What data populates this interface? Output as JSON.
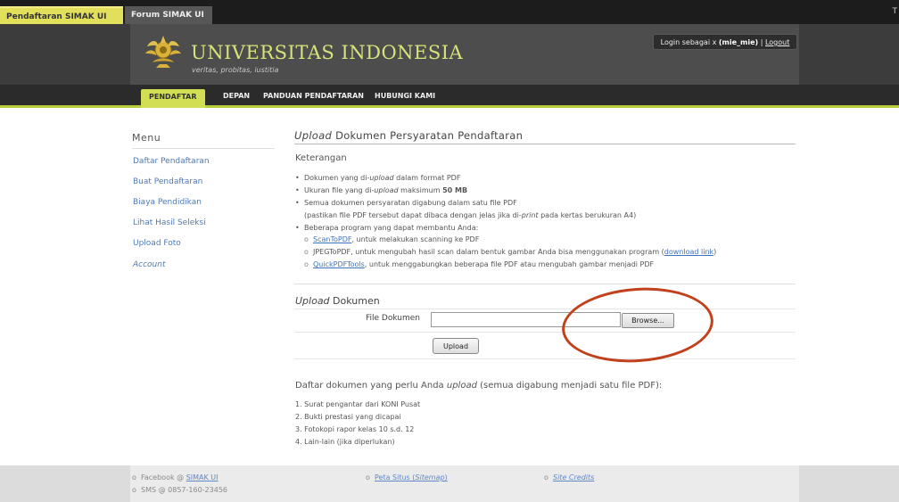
{
  "top_tabs": [
    {
      "label": "Pendaftaran SIMAK UI",
      "active": true
    },
    {
      "label": "Forum SIMAK UI",
      "active": false
    }
  ],
  "top_edge_text": "T",
  "header": {
    "title": "UNIVERSITAS INDONESIA",
    "motto": "veritas, probitas, iustitia",
    "login_prefix": "Login sebagai x ",
    "login_user": "(mie_mie)",
    "login_sep": " | ",
    "logout": "Logout"
  },
  "nav": [
    "PENDAFTAR",
    "DEPAN",
    "PANDUAN PENDAFTARAN",
    "HUBUNGI KAMI"
  ],
  "sidebar": {
    "title": "Menu",
    "items": [
      "Daftar Pendaftaran",
      "Buat Pendaftaran",
      "Biaya Pendidikan",
      "Lihat Hasil Seleksi",
      "Upload Foto",
      "Account"
    ]
  },
  "main": {
    "title_italic": "Upload",
    "title_rest": " Dokumen Persyaratan Pendaftaran",
    "keterangan": "Keterangan",
    "notes": {
      "n1_a": "Dokumen yang di-",
      "n1_i": "upload",
      "n1_b": " dalam format PDF",
      "n2_a": "Ukuran file yang di-",
      "n2_i": "upload",
      "n2_b": " maksimum ",
      "n2_c": "50 MB",
      "n3": "Semua dokumen persyaratan digabung dalam satu file PDF",
      "n3_sub_a": "(pastikan file PDF tersebut dapat dibaca dengan jelas jika di-",
      "n3_sub_i": "print",
      "n3_sub_b": " pada kertas berukuran A4)",
      "n4": "Beberapa program yang dapat membantu Anda:",
      "p1_link": "ScanToPDF",
      "p1_text": ", untuk melakukan scanning ke PDF",
      "p2_text": "JPEGToPDF, untuk mengubah hasil scan dalam bentuk gambar Anda bisa menggunakan program (",
      "p2_link": "download link",
      "p2_close": ")",
      "p3_link": "QuickPDFTools",
      "p3_text": ", untuk menggabungkan beberapa file PDF atau mengubah gambar menjadi PDF"
    },
    "upload": {
      "title_italic": "Upload",
      "title_rest": " Dokumen",
      "field_label": "File Dokumen",
      "file_value": "",
      "browse": "Browse...",
      "submit": "Upload"
    },
    "list": {
      "title_a": "Daftar dokumen yang perlu Anda ",
      "title_i": "upload",
      "title_b": " (semua digabung menjadi satu file PDF):",
      "items": [
        "1.  Surat pengantar dari KONI Pusat",
        "2.  Bukti prestasi yang dicapai",
        "3.  Fotokopi rapor kelas 10 s.d. 12",
        "4.  Lain-lain (jika diperlukan)"
      ]
    }
  },
  "footer": {
    "facebook_prefix": "Facebook @ ",
    "facebook_link": "SIMAK UI",
    "sms": "SMS @ 0857-160-23456",
    "sitemap_a": "Peta Situs (",
    "sitemap_i": "Sitemap",
    "sitemap_b": ")",
    "credits": "Site Credits",
    "bullet": "o"
  },
  "colors": {
    "accent": "#d2df54",
    "link": "#4e79b8",
    "annotation": "#c0411c"
  }
}
